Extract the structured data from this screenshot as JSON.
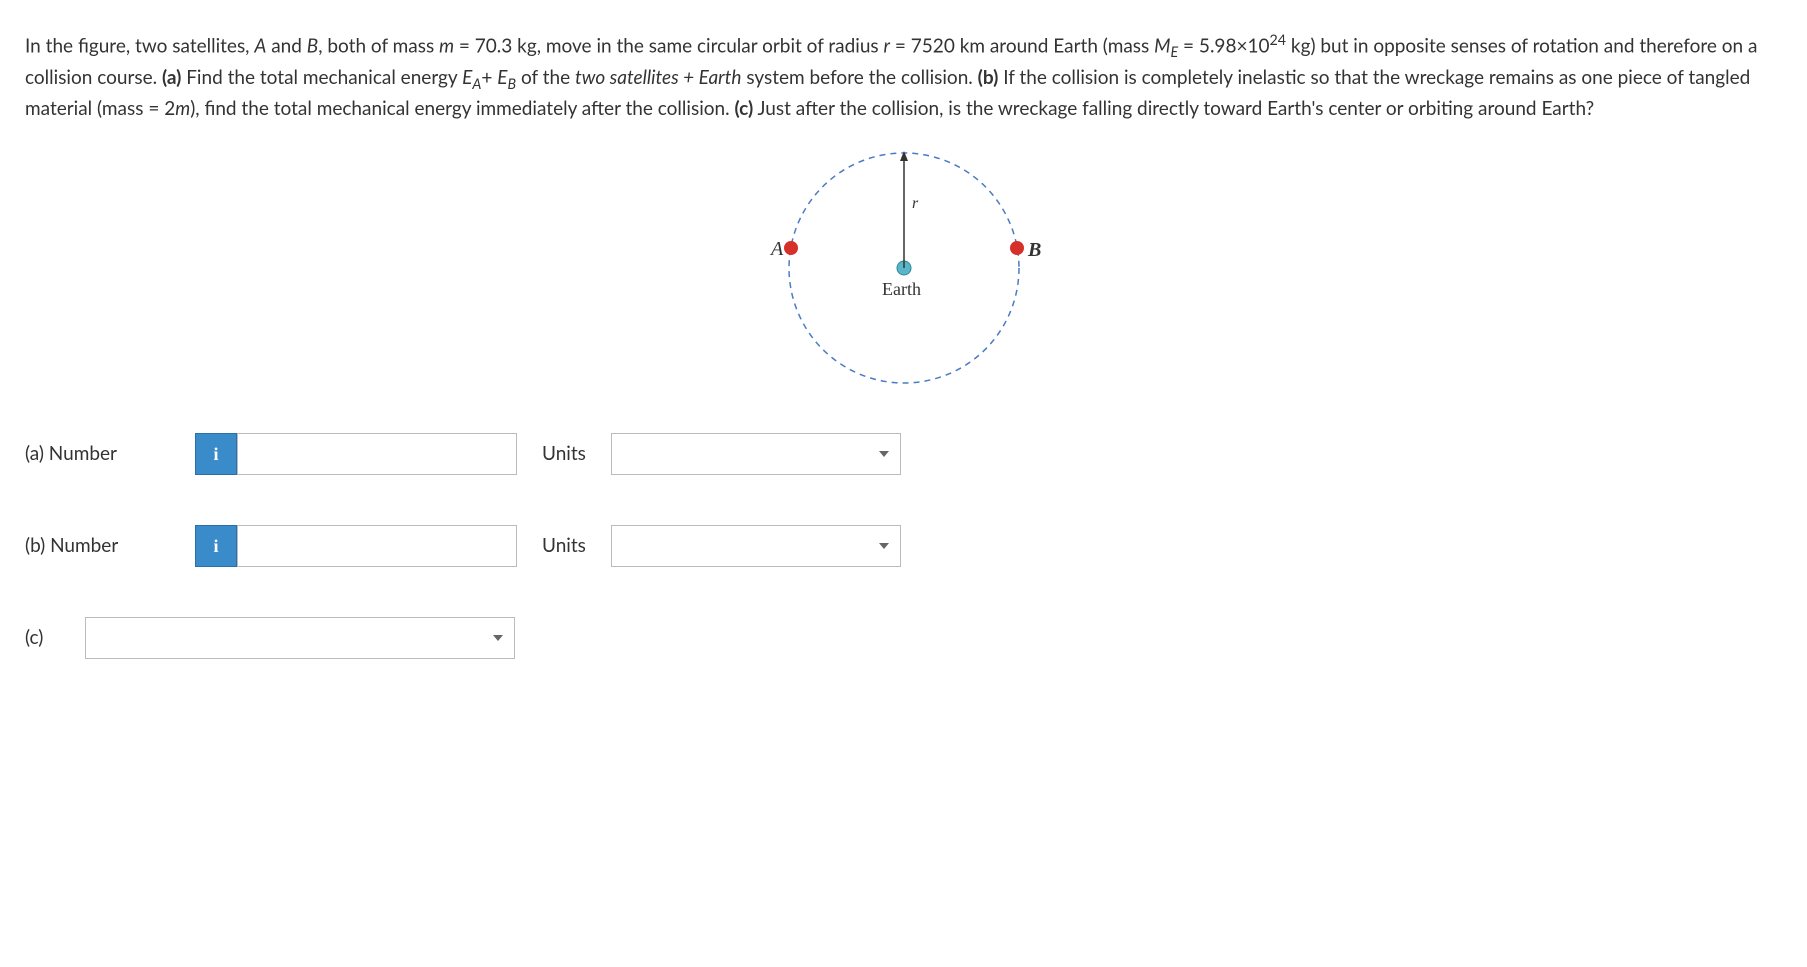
{
  "problem": {
    "p1": "In the figure, two satellites, ",
    "p2": " and ",
    "p3": ", both of mass ",
    "p4": " = 70.3 kg, move in the same circular orbit of radius ",
    "p5": " = 7520 km around Earth (mass ",
    "p6": " = 5.98×10",
    "p7": " kg) but in opposite senses of rotation and therefore on a collision course. ",
    "p8": " Find the total mechanical energy ",
    "p9": "+ ",
    "p10": " of the ",
    "p11": "two satellites + Earth",
    "p12": " system before the collision. ",
    "p13": " If the collision is completely inelastic so that the wreckage remains as one piece of tangled material (mass = 2",
    "p14": "), find the total mechanical energy immediately after the collision. ",
    "p15": " Just after the collision, is the wreckage falling directly toward Earth's center or orbiting around Earth?",
    "labelA": "A",
    "labelB": "B",
    "labelm": "m",
    "labelr": "r",
    "labelME": "M",
    "labelMEsub": "E",
    "exp24": "24",
    "partA": "(a)",
    "partB": "(b)",
    "partC": "(c)",
    "labelEA": "E",
    "labelEAsub": "A",
    "labelEB": "E",
    "labelEBsub": "B"
  },
  "figure": {
    "labelA": "A",
    "labelB": "B",
    "labelEarth": "Earth",
    "labelr": "r"
  },
  "answers": {
    "a": {
      "label": "(a)   Number",
      "units": "Units",
      "info": "i",
      "value": ""
    },
    "b": {
      "label": "(b)   Number",
      "units": "Units",
      "info": "i",
      "value": ""
    },
    "c": {
      "label": "(c)",
      "value": ""
    }
  }
}
